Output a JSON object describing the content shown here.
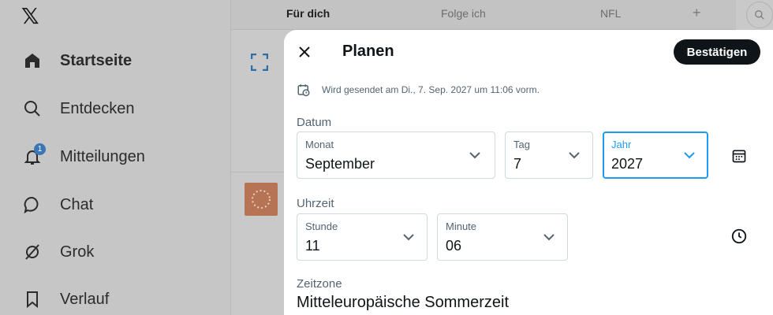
{
  "sidebar": {
    "items": [
      {
        "label": "Startseite",
        "icon": "home-icon",
        "active": true
      },
      {
        "label": "Entdecken",
        "icon": "search-icon"
      },
      {
        "label": "Mitteilungen",
        "icon": "bell-icon",
        "badge": "1"
      },
      {
        "label": "Chat",
        "icon": "chat-bubble-icon"
      },
      {
        "label": "Grok",
        "icon": "grok-icon"
      },
      {
        "label": "Verlauf",
        "icon": "bookmark-icon"
      }
    ]
  },
  "topbar": {
    "tabs": [
      "Für dich",
      "Folge ich",
      "NFL"
    ],
    "add": "+"
  },
  "modal": {
    "title": "Planen",
    "confirm": "Bestätigen",
    "send_info": "Wird gesendet am Di., 7. Sep. 2027 um 11:06 vorm.",
    "date": {
      "label": "Datum",
      "month_label": "Monat",
      "month_value": "September",
      "day_label": "Tag",
      "day_value": "7",
      "year_label": "Jahr",
      "year_value": "2027"
    },
    "time": {
      "label": "Uhrzeit",
      "hour_label": "Stunde",
      "hour_value": "11",
      "minute_label": "Minute",
      "minute_value": "06"
    },
    "timezone": {
      "label": "Zeitzone",
      "value": "Mitteleuropäische Sommerzeit"
    }
  },
  "colors": {
    "accent": "#1d9bf0",
    "dark": "#0f1419",
    "muted": "#536471"
  }
}
